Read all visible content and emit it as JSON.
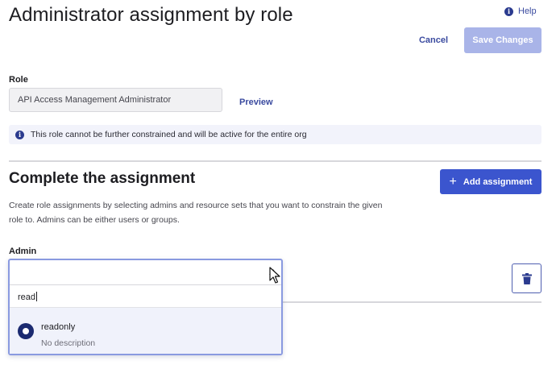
{
  "header": {
    "title": "Administrator assignment by role",
    "help_label": "Help",
    "cancel_label": "Cancel",
    "save_label": "Save Changes"
  },
  "role": {
    "label": "Role",
    "value": "API Access Management Administrator",
    "preview_label": "Preview"
  },
  "notice": {
    "text": "This role cannot be further constrained and will be active for the entire org"
  },
  "assignment": {
    "title": "Complete the assignment",
    "add_label": "Add assignment",
    "description": "Create role assignments by selecting admins and resource sets that you want to constrain the given role to. Admins can be either users or groups."
  },
  "admin": {
    "label": "Admin",
    "search_value": "read",
    "options": [
      {
        "title": "readonly",
        "subtitle": "No description",
        "selected": true
      }
    ]
  },
  "colors": {
    "primary": "#3b55ce",
    "primary_disabled": "#a9b4e8",
    "link": "#3a4a9f",
    "radio_selected": "#1b2a70",
    "notice_bg": "#f2f3fb"
  },
  "icons": {
    "help": "info-circle-icon",
    "notice": "info-circle-icon",
    "add": "plus-icon",
    "delete": "trash-icon",
    "combo": "chevron-up-icon"
  }
}
